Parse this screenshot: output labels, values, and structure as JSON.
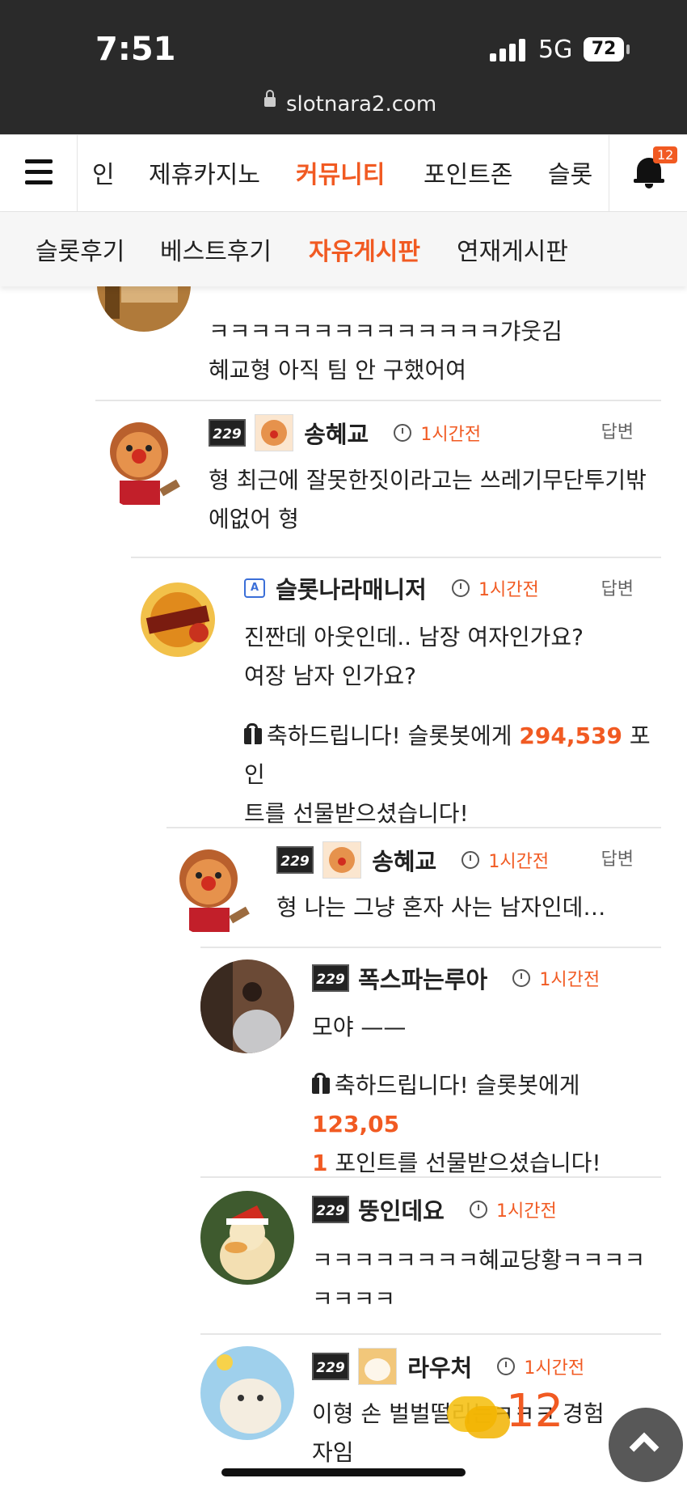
{
  "status": {
    "time": "7:51",
    "network": "5G",
    "battery": "72"
  },
  "browser": {
    "url": "slotnara2.com"
  },
  "nav": {
    "items": [
      "인",
      "제휴카지노",
      "커뮤니티",
      "포인트존",
      "슬롯"
    ],
    "active": "커뮤니티",
    "notification_count": "12"
  },
  "subnav": {
    "items": [
      "슬롯후기",
      "베스트후기",
      "자유게시판",
      "연재게시판"
    ],
    "active": "자유게시판"
  },
  "comments": [
    {
      "user": "",
      "time": "",
      "reply": "",
      "lines": [
        "ㅋㅋㅋㅋㅋㅋㅋㅋㅋㅋㅋㅋㅋㅋ갸웃김",
        "혜교형 아직 팀 안 구했어여"
      ]
    },
    {
      "user": "송혜교",
      "level": "229",
      "time": "1시간전",
      "reply": "답변",
      "lines": [
        "형 최근에 잘못한짓이라고는 쓰레기무단투기밖",
        "에없어 형"
      ]
    },
    {
      "user": "슬롯나라매니저",
      "level": "A",
      "time": "1시간전",
      "reply": "답변",
      "lines": [
        "진짠데 아웃인데.. 남장 여자인가요?",
        "여장 남자 인가요?"
      ],
      "gift": {
        "prefix": "축하드립니다! 슬롯봇에게 ",
        "points": "294,539",
        "suffix": " 포인",
        "line2": "트를 선물받으셨습니다!"
      }
    },
    {
      "user": "송혜교",
      "level": "229",
      "time": "1시간전",
      "reply": "답변",
      "lines": [
        "형 나는 그냥 혼자 사는 남자인데…"
      ]
    },
    {
      "user": "폭스파는루아",
      "level": "229",
      "time": "1시간전",
      "reply": "",
      "lines": [
        "모야 ——"
      ],
      "gift": {
        "prefix": "축하드립니다! 슬롯봇에게 ",
        "points": "123,05",
        "line2_points": "1",
        "line2": " 포인트를 선물받으셨습니다!"
      }
    },
    {
      "user": "뚱인데요",
      "level": "229",
      "time": "1시간전",
      "reply": "",
      "lines": [
        "ㅋㅋㅋㅋㅋㅋㅋㅋ혜교당황ㅋㅋㅋㅋ",
        "ㅋㅋㅋㅋ"
      ]
    },
    {
      "user": "라우처",
      "level": "229",
      "time": "1시간전",
      "reply": "",
      "lines": [
        "이형 손 벌벌떨리는ㅋㅋㅋ 경험",
        "자임"
      ]
    }
  ],
  "float": {
    "chat_count": "12"
  },
  "colors": {
    "accent": "#f15a22",
    "statusbar": "#2a2a2a"
  },
  "icons": [
    "menu-icon",
    "bell-icon",
    "lock-icon",
    "clock-icon",
    "gift-icon",
    "chat-icon",
    "chevron-up-icon"
  ]
}
